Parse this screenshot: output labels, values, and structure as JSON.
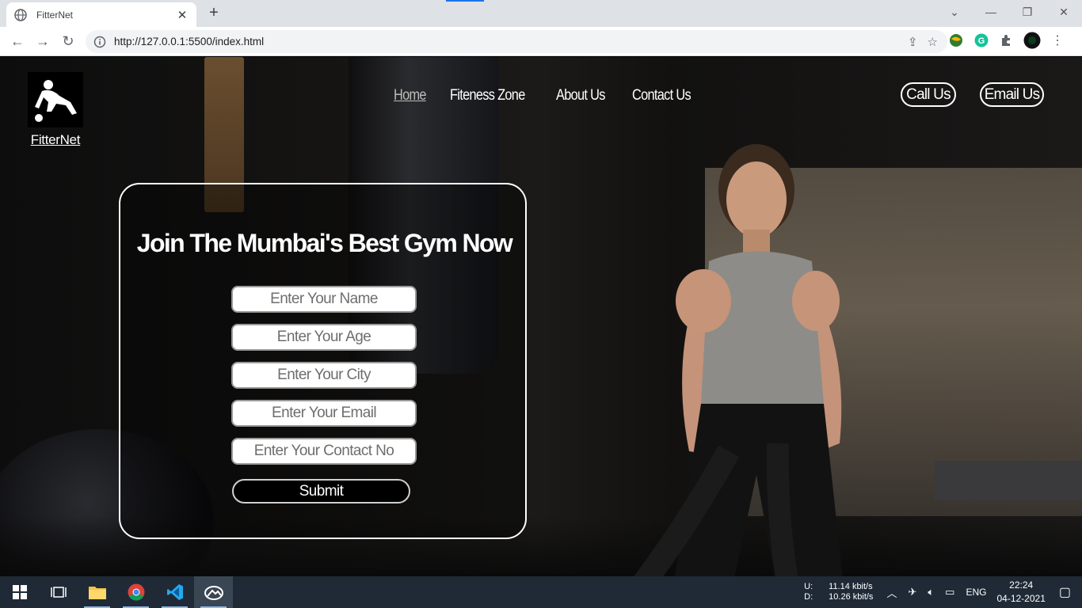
{
  "browser": {
    "tab_title": "FitterNet",
    "url": "http://127.0.0.1:5500/index.html"
  },
  "site": {
    "brand": "FitterNet",
    "nav": [
      "Home",
      "Fiteness Zone",
      "About Us",
      "Contact Us"
    ],
    "active_nav": "Home",
    "call_label": "Call Us",
    "email_label": "Email Us"
  },
  "form": {
    "title": "Join The Mumbai's Best Gym Now",
    "fields": [
      {
        "placeholder": "Enter Your Name"
      },
      {
        "placeholder": "Enter Your Age"
      },
      {
        "placeholder": "Enter Your City"
      },
      {
        "placeholder": "Enter Your Email"
      },
      {
        "placeholder": "Enter Your Contact No"
      }
    ],
    "submit_label": "Submit"
  },
  "taskbar": {
    "upload_label": "U:",
    "download_label": "D:",
    "upload_speed": "11.14 kbit/s",
    "download_speed": "10.26 kbit/s",
    "language": "ENG",
    "time": "22:24",
    "date": "04-12-2021"
  },
  "colors": {
    "accent": "#ffffff",
    "taskbar": "#1f2a36",
    "chrome_tabbar": "#dee1e6"
  }
}
